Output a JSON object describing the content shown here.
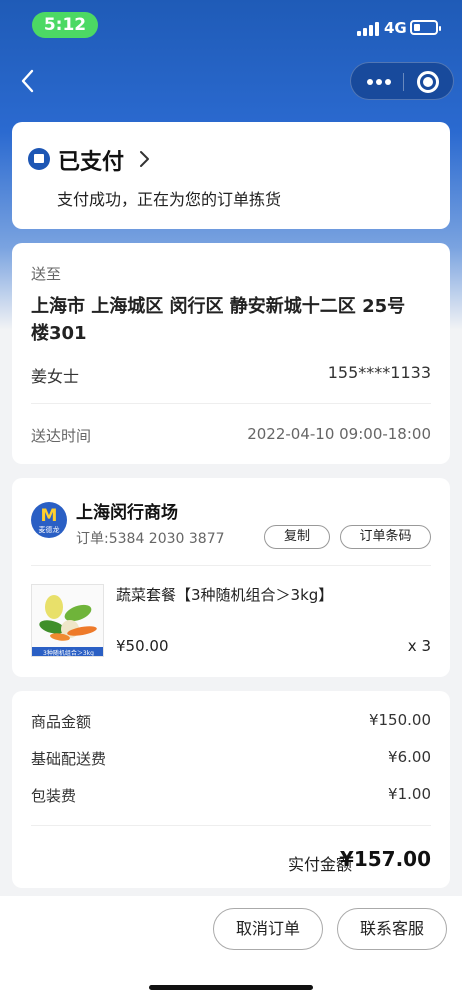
{
  "status_bar": {
    "time": "5:12",
    "network": "4G"
  },
  "order_status": {
    "title": "已支付",
    "subtitle": "支付成功，正在为您的订单拣货"
  },
  "address": {
    "label": "送至",
    "text": "上海市 上海城区 闵行区 静安新城十二区 25号楼301",
    "name": "姜女士",
    "phone": "155****1133",
    "delivery_time_label": "送达时间",
    "delivery_time": "2022-04-10 09:00-18:00"
  },
  "store": {
    "logo_text": "麦德龙",
    "name": "上海闵行商场",
    "order_no": "订单:5384 2030 3877",
    "copy_label": "复制",
    "barcode_label": "订单条码"
  },
  "product": {
    "name": "蔬菜套餐【3种随机组合＞3kg】",
    "price": "¥50.00",
    "qty": "x 3",
    "image_caption": "3种随机组合＞3kg"
  },
  "summary": {
    "goods_label": "商品金额",
    "goods_value": "¥150.00",
    "delivery_label": "基础配送费",
    "delivery_value": "¥6.00",
    "packing_label": "包装费",
    "packing_value": "¥1.00",
    "total_label": "实付金额",
    "total_value": "¥157.00"
  },
  "actions": {
    "cancel": "取消订单",
    "service": "联系客服"
  },
  "colors": {
    "brand_blue": "#1f5bb7",
    "status_green": "#4cd964",
    "logo_yellow": "#ffcf2e"
  }
}
